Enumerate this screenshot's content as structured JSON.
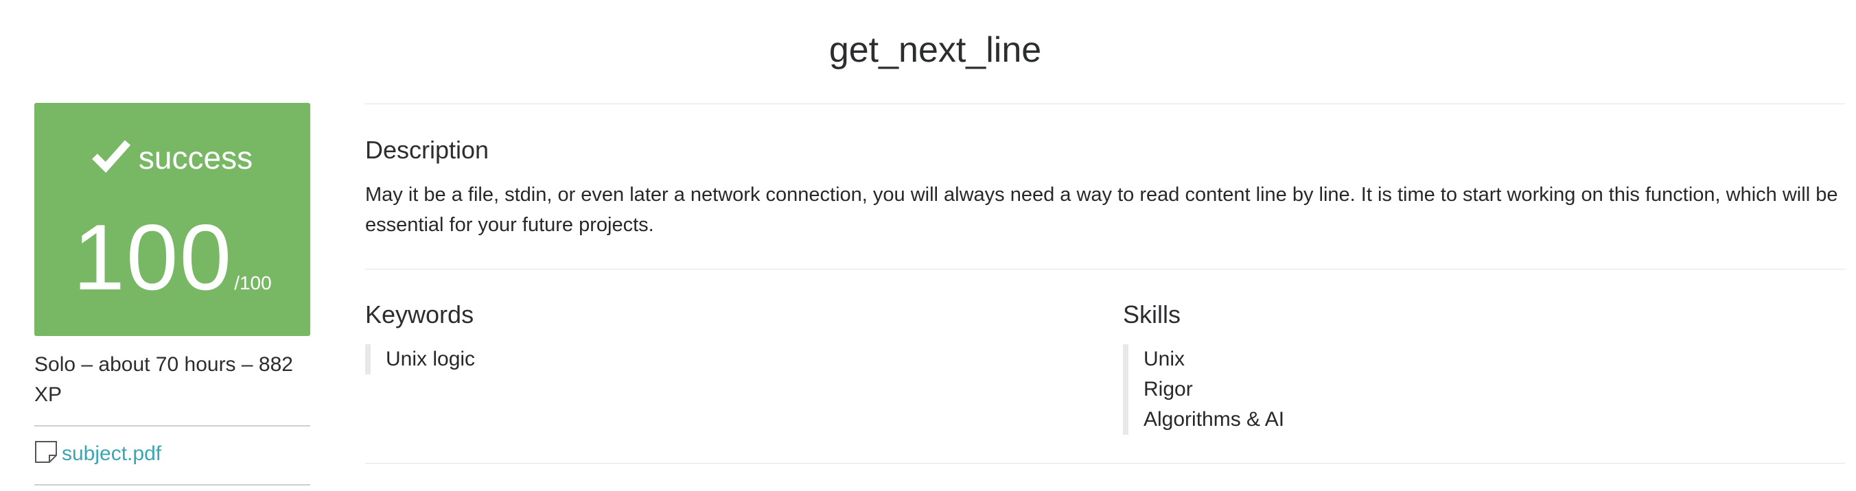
{
  "project": {
    "title": "get_next_line"
  },
  "score_card": {
    "status_icon": "check-icon",
    "status": "success",
    "score": "100",
    "max_score": "/100",
    "color": "#78b865"
  },
  "meta": {
    "info": "Solo – about 70 hours – 882 XP"
  },
  "attachments": {
    "icon": "file-icon",
    "subject_link": "subject.pdf",
    "link_color": "#3aa6b4"
  },
  "description": {
    "heading": "Description",
    "text": "May it be a file, stdin, or even later a network connection, you will always need a way to read content line by line. It is time to start working on this function, which will be essential for your future projects."
  },
  "keywords": {
    "heading": "Keywords",
    "items": [
      "Unix logic"
    ]
  },
  "skills": {
    "heading": "Skills",
    "items": [
      "Unix",
      "Rigor",
      "Algorithms & AI"
    ]
  }
}
